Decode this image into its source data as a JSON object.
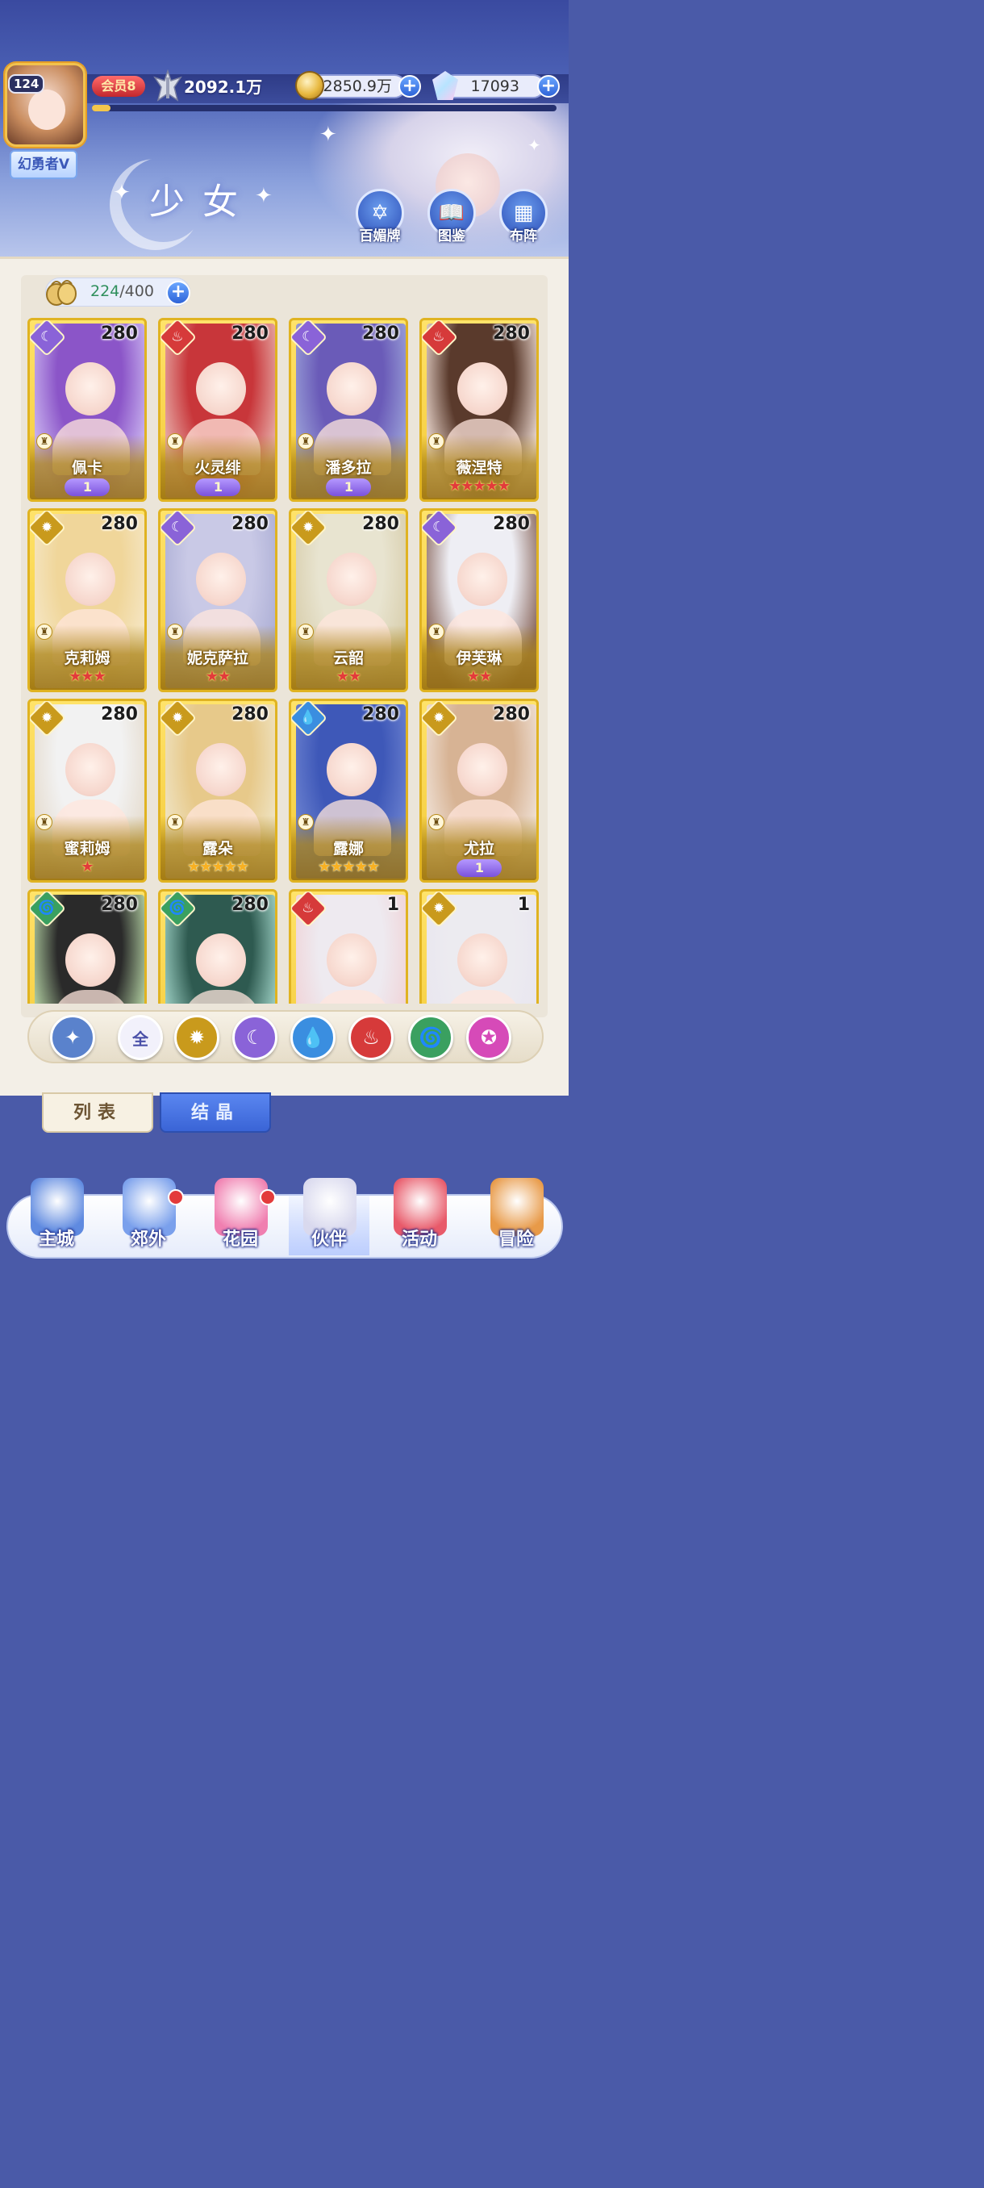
{
  "header": {
    "player_level": "124",
    "title": "幻勇者V",
    "vip": "会员8",
    "power": "2092.1万",
    "xp_fraction": 0.04,
    "gold": "2850.9万",
    "gems": "17093",
    "page_title": "少女",
    "buttons": [
      {
        "label": "百媚牌",
        "icon": "card-icon"
      },
      {
        "label": "图鉴",
        "icon": "book-icon"
      },
      {
        "label": "布阵",
        "icon": "grid-icon"
      }
    ]
  },
  "inventory": {
    "current": "224",
    "separator": "/",
    "max": "400"
  },
  "elements": {
    "moon": {
      "color": "#8a63d8",
      "glyph": "☾"
    },
    "fire": {
      "color": "#d63a3a",
      "glyph": "♨"
    },
    "sun": {
      "color": "#c99a1c",
      "glyph": "✹"
    },
    "water": {
      "color": "#3a8ee0",
      "glyph": "💧"
    },
    "wind": {
      "color": "#3aa060",
      "glyph": "🌀"
    }
  },
  "cards": [
    {
      "name": "佩卡",
      "level": "280",
      "element": "moon",
      "rank_type": "awaken",
      "awaken": "1",
      "stars": 0,
      "star_color": "",
      "hair": "#8b55c8",
      "bg": "#c9b3ef"
    },
    {
      "name": "火灵绯",
      "level": "280",
      "element": "fire",
      "rank_type": "awaken",
      "awaken": "1",
      "stars": 0,
      "star_color": "",
      "hair": "#c8363a",
      "bg": "#e6aaa6"
    },
    {
      "name": "潘多拉",
      "level": "280",
      "element": "moon",
      "rank_type": "awaken",
      "awaken": "1",
      "stars": 0,
      "star_color": "",
      "hair": "#6a5bb8",
      "bg": "#9aa0d8"
    },
    {
      "name": "薇涅特",
      "level": "280",
      "element": "fire",
      "rank_type": "stars",
      "awaken": "",
      "stars": 5,
      "star_color": "red",
      "hair": "#5a3a2c",
      "bg": "#e8d5cc"
    },
    {
      "name": "克莉姆",
      "level": "280",
      "element": "sun",
      "rank_type": "stars",
      "awaken": "",
      "stars": 3,
      "star_color": "red",
      "hair": "#f0d69a",
      "bg": "#f5e6c4"
    },
    {
      "name": "妮克萨拉",
      "level": "280",
      "element": "moon",
      "rank_type": "stars",
      "awaken": "",
      "stars": 2,
      "star_color": "red",
      "hair": "#c9c9e6",
      "bg": "#aeb0d6"
    },
    {
      "name": "云韶",
      "level": "280",
      "element": "sun",
      "rank_type": "stars",
      "awaken": "",
      "stars": 2,
      "star_color": "red",
      "hair": "#e8e4d0",
      "bg": "#d9cfae"
    },
    {
      "name": "伊芙琳",
      "level": "280",
      "element": "moon",
      "rank_type": "stars",
      "awaken": "",
      "stars": 2,
      "star_color": "red",
      "hair": "#eeeef4",
      "bg": "#8c6a60"
    },
    {
      "name": "蜜莉姆",
      "level": "280",
      "element": "sun",
      "rank_type": "stars",
      "awaken": "",
      "stars": 1,
      "star_color": "red",
      "hair": "#f2f2f2",
      "bg": "#e6ddd0"
    },
    {
      "name": "露朵",
      "level": "280",
      "element": "sun",
      "rank_type": "stars",
      "awaken": "",
      "stars": 5,
      "star_color": "gold",
      "hair": "#e7c98a",
      "bg": "#efe3c2"
    },
    {
      "name": "露娜",
      "level": "280",
      "element": "water",
      "rank_type": "stars",
      "awaken": "",
      "stars": 5,
      "star_color": "gold",
      "hair": "#3e58b8",
      "bg": "#6a80cf"
    },
    {
      "name": "尤拉",
      "level": "280",
      "element": "sun",
      "rank_type": "awaken",
      "awaken": "1",
      "stars": 0,
      "star_color": "",
      "hair": "#d7b394",
      "bg": "#efe0d4"
    },
    {
      "name": "",
      "level": "280",
      "element": "wind",
      "rank_type": "none",
      "awaken": "",
      "stars": 0,
      "star_color": "",
      "hair": "#2a2a2a",
      "bg": "#b7d6a6"
    },
    {
      "name": "",
      "level": "280",
      "element": "wind",
      "rank_type": "none",
      "awaken": "",
      "stars": 0,
      "star_color": "",
      "hair": "#2e5a50",
      "bg": "#9fd2c6"
    },
    {
      "name": "",
      "level": "1",
      "element": "fire",
      "rank_type": "none",
      "awaken": "",
      "stars": 0,
      "star_color": "",
      "hair": "#eeeaf0",
      "bg": "#f0d4d8"
    },
    {
      "name": "",
      "level": "1",
      "element": "sun",
      "rank_type": "none",
      "awaken": "",
      "stars": 0,
      "star_color": "",
      "hair": "#ecebf0",
      "bg": "#e9e6ef"
    }
  ],
  "filters": [
    {
      "name": "filter-special-button",
      "label": "✦",
      "color": "#5a82cc"
    },
    {
      "name": "filter-all-button",
      "label": "全",
      "color": "#f2f1fb",
      "text_color": "#4a50a8"
    },
    {
      "name": "filter-sun-button",
      "label": "✹",
      "color": "#c99a1c"
    },
    {
      "name": "filter-moon-button",
      "label": "☾",
      "color": "#8a63d8"
    },
    {
      "name": "filter-water-button",
      "label": "💧",
      "color": "#3a8ee0"
    },
    {
      "name": "filter-fire-button",
      "label": "♨",
      "color": "#d63a3a"
    },
    {
      "name": "filter-wind-button",
      "label": "🌀",
      "color": "#3aa060"
    },
    {
      "name": "filter-star-button",
      "label": "✪",
      "color": "#d64ab8"
    }
  ],
  "tabs": {
    "list": "列表",
    "crystal": "结晶"
  },
  "nav": [
    {
      "label": "主城",
      "icon": "castle-icon",
      "badge": false,
      "active": false,
      "color": "#5f8ae0"
    },
    {
      "label": "郊外",
      "icon": "portal-icon",
      "badge": true,
      "active": false,
      "color": "#7aa0ec"
    },
    {
      "label": "花园",
      "icon": "heart-icon",
      "badge": true,
      "active": false,
      "color": "#f07fb0"
    },
    {
      "label": "伙伴",
      "icon": "partner-icon",
      "badge": false,
      "active": true,
      "color": "#d9d9ee"
    },
    {
      "label": "活动",
      "icon": "gift-icon",
      "badge": false,
      "active": false,
      "color": "#e85a6a"
    },
    {
      "label": "冒险",
      "icon": "compass-icon",
      "badge": false,
      "active": false,
      "color": "#e89a48"
    }
  ]
}
